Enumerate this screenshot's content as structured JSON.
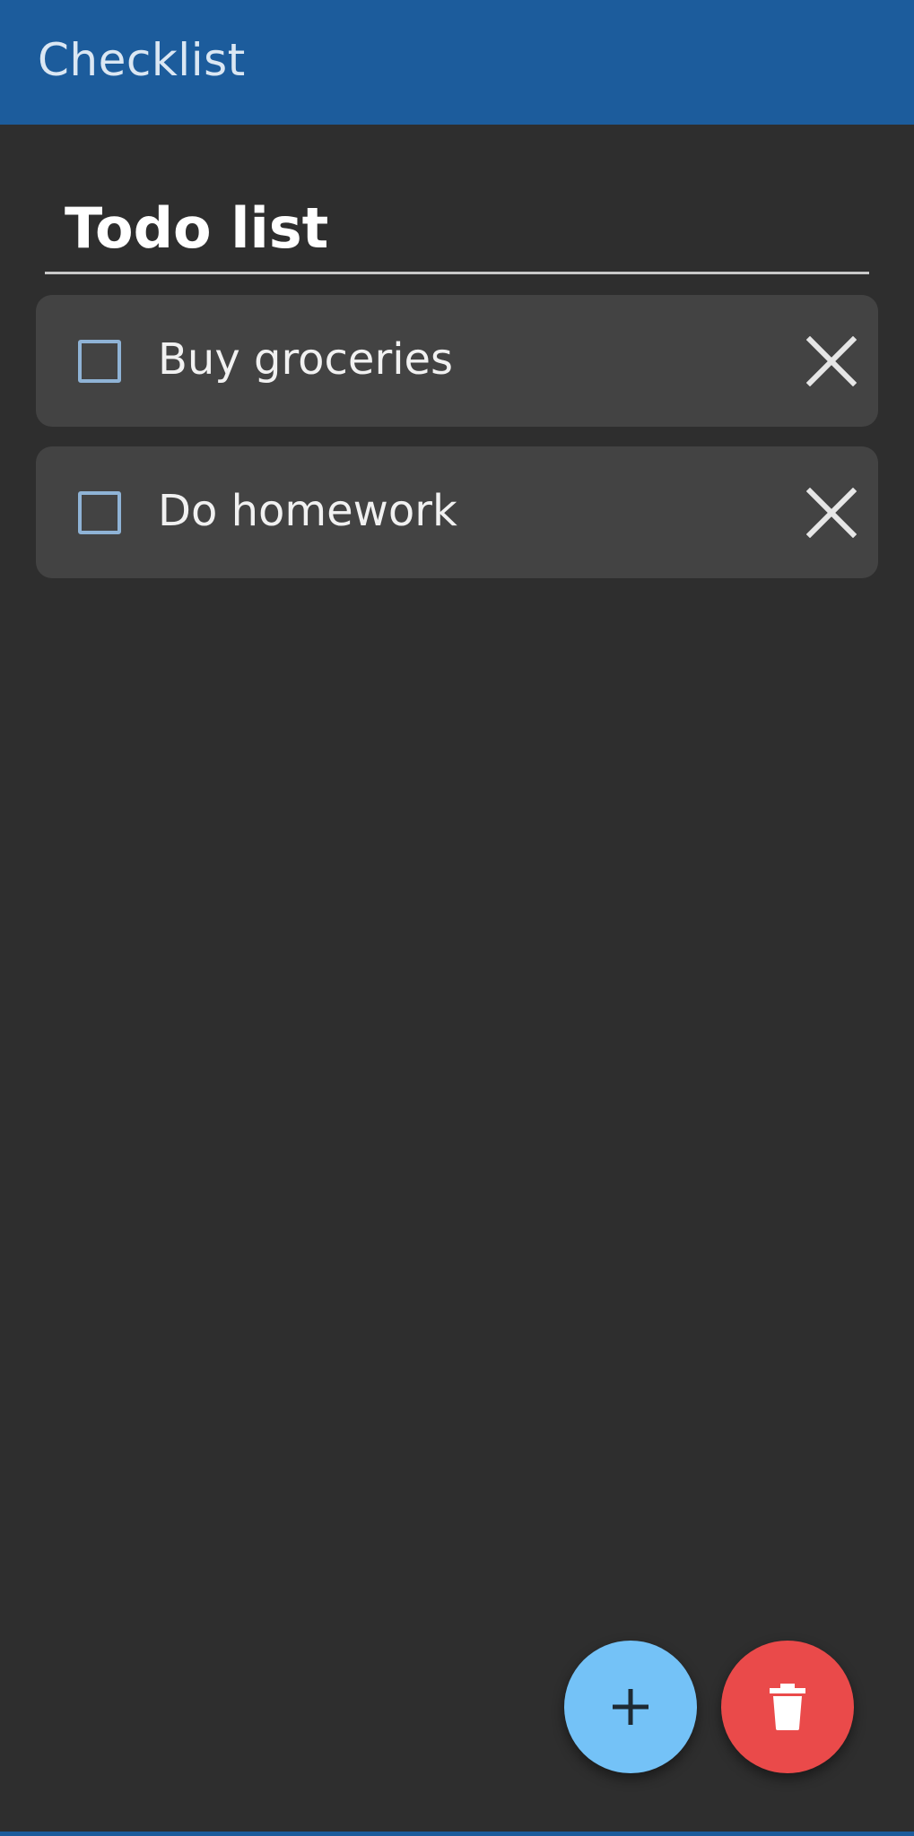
{
  "app_bar": {
    "title": "Checklist"
  },
  "list": {
    "title": "Todo list",
    "items": [
      {
        "label": "Buy groceries",
        "checked": false
      },
      {
        "label": "Do homework",
        "checked": false
      }
    ]
  },
  "fabs": {
    "add_icon": "plus-icon",
    "delete_icon": "trash-icon"
  },
  "colors": {
    "app_bar": "#1c5c9c",
    "background": "#2e2e2e",
    "row": "#434343",
    "checkbox": "#8fb3d6",
    "fab_add": "#74c2f7",
    "fab_delete": "#ea4a4a"
  }
}
